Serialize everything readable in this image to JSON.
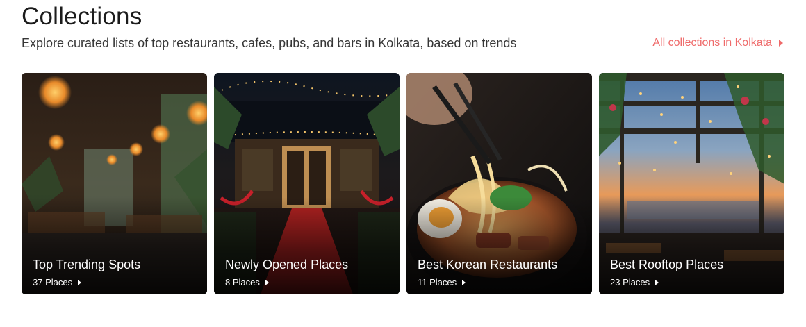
{
  "header": {
    "title": "Collections",
    "subtitle": "Explore curated lists of top restaurants, cafes, pubs, and bars in Kolkata, based on trends",
    "all_link": "All collections in Kolkata"
  },
  "accent_color": "#ef6a6a",
  "collections": [
    {
      "name": "Top Trending Spots",
      "places": "37 Places",
      "image": "restaurant-interior-with-lanterns"
    },
    {
      "name": "Newly Opened Places",
      "places": "8 Places",
      "image": "restaurant-entrance-red-carpet"
    },
    {
      "name": "Best Korean Restaurants",
      "places": "11 Places",
      "image": "ramen-bowl-with-chopsticks"
    },
    {
      "name": "Best Rooftop Places",
      "places": "23 Places",
      "image": "rooftop-terrace-sunset-view"
    }
  ]
}
